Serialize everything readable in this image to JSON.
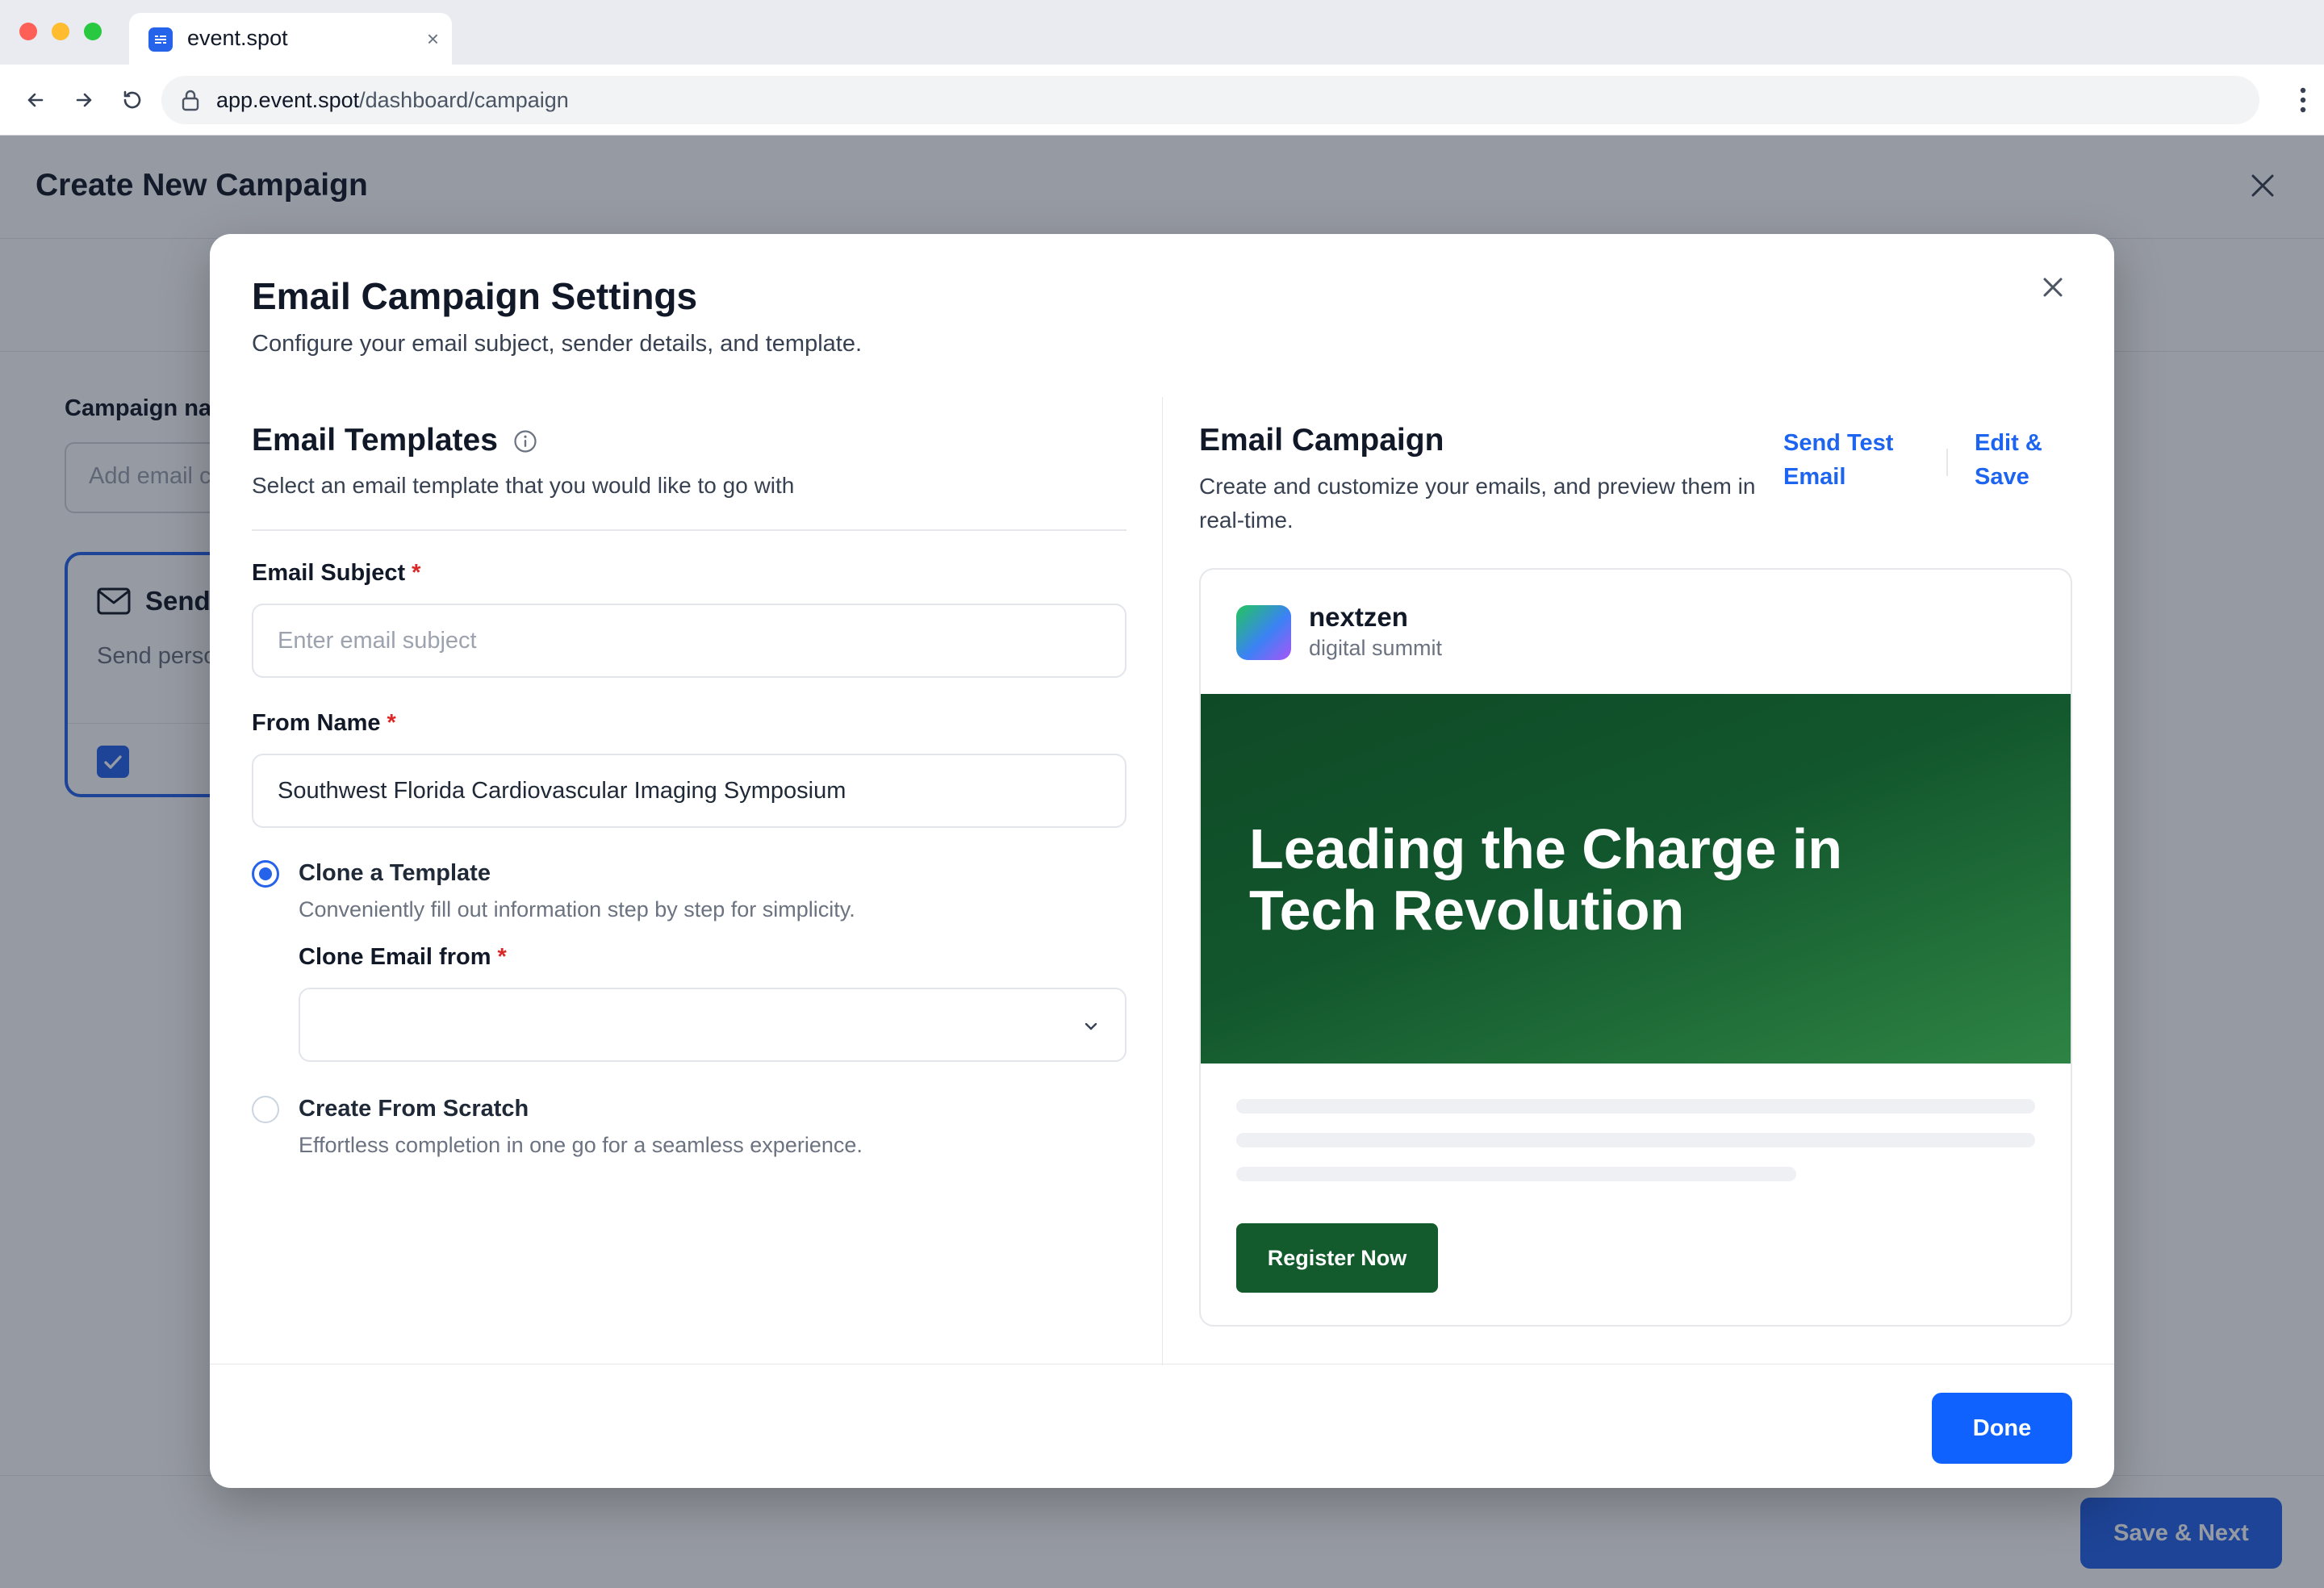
{
  "browser": {
    "tab_title": "event.spot",
    "tab_close": "×",
    "url_host": "app.event.spot",
    "url_path": "/dashboard/campaign"
  },
  "page": {
    "title": "Create New Campaign",
    "campaign_label": "Campaign na",
    "campaign_placeholder": "Add email c",
    "card_title": "Send",
    "card_desc": "Send perso attendees",
    "save_next_label": "Save & Next"
  },
  "modal": {
    "title": "Email Campaign Settings",
    "subtitle": "Configure your email subject, sender details, and template.",
    "done_label": "Done",
    "templates": {
      "title": "Email Templates",
      "desc": "Select an email template that you would like to go with"
    },
    "subject": {
      "label": "Email Subject",
      "required": "*",
      "placeholder": "Enter email subject",
      "value": ""
    },
    "from_name": {
      "label": "From Name",
      "required": "*",
      "value": "Southwest Florida Cardiovascular Imaging Symposium"
    },
    "options": [
      {
        "title": "Clone a Template",
        "desc": "Conveniently fill out information step by step for simplicity.",
        "selected": true
      },
      {
        "title": "Create From Scratch",
        "desc": "Effortless completion in one go for a seamless experience.",
        "selected": false
      }
    ],
    "clone_from": {
      "label": "Clone Email from",
      "required": "*",
      "value": ""
    },
    "campaign": {
      "title": "Email Campaign",
      "desc": "Create and customize your emails, and preview them in real-time.",
      "send_test_label": "Send Test Email",
      "edit_save_label": "Edit & Save"
    },
    "preview": {
      "brand": "nextzen",
      "brand_sub": "digital summit",
      "hero_title": "Leading the Charge in Tech Revolution",
      "cta_label": "Register Now"
    }
  },
  "colors": {
    "accent": "#0f62fe",
    "link": "#1d64f0",
    "required": "#dc2626",
    "hero_green": "#12562d",
    "cta_green": "#135a2c"
  },
  "icons": [
    "back-arrow-icon",
    "forward-arrow-icon",
    "reload-icon",
    "lock-icon",
    "kebab-menu-icon",
    "close-icon",
    "info-icon",
    "mail-icon",
    "check-icon",
    "chevron-down-icon"
  ]
}
